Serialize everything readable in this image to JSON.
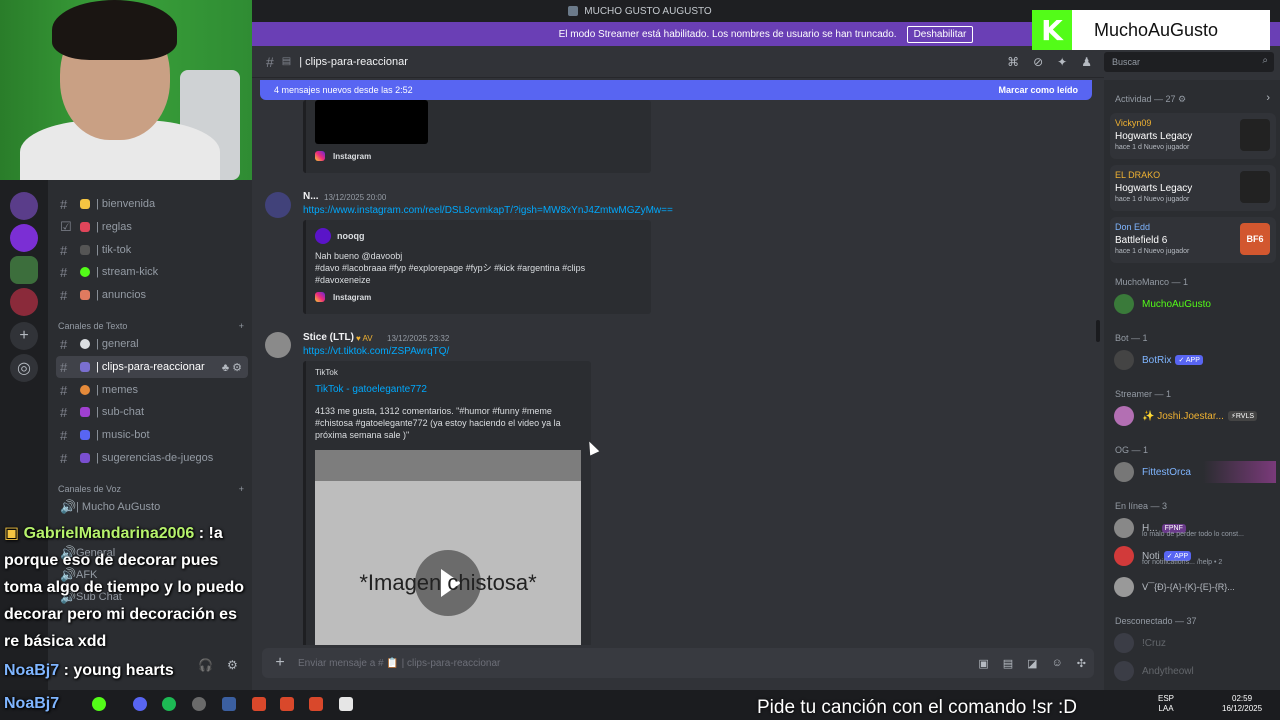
{
  "window": {
    "title": "MUCHO GUSTO AUGUSTO"
  },
  "banner": {
    "text": "El modo Streamer está habilitado. Los nombres de usuario se han truncado.",
    "button": "Deshabilitar"
  },
  "header": {
    "channel": "| clips-para-reaccionar"
  },
  "search": {
    "placeholder": "Buscar"
  },
  "new_messages": {
    "text": "4 mensajes nuevos desde las 2:52",
    "mark": "Marcar como leído"
  },
  "sidebar": {
    "channels_top": [
      "| bienvenida",
      "| reglas",
      "| tik-tok",
      "| stream-kick",
      "| anuncios"
    ],
    "text_category": "Canales de Texto",
    "text_channels": [
      "| general",
      "| clips-para-reaccionar",
      "| memes",
      "| sub-chat",
      "| music-bot",
      "| sugerencias-de-juegos"
    ],
    "voice_category": "Canales de Voz",
    "voice_channels": [
      "| Mucho AuGusto",
      "General",
      "AFK",
      "Sub Chat"
    ]
  },
  "messages": {
    "m0": {
      "embed_source": "Instagram"
    },
    "m1": {
      "user": "N...",
      "time": "13/12/2025 20:00",
      "link": "https://www.instagram.com/reel/DSL8cvmkapT/?igsh=MW8xYnJ4ZmtwMGZyMw==",
      "embed_author": "nooqg",
      "embed_line1": "Nah bueno @davoobj",
      "embed_line2": "#davo #lacobraaa #fyp #explorepage #fypシ #kick #argentina #clips",
      "embed_line3": "#davoxeneize",
      "embed_source": "Instagram"
    },
    "m2": {
      "user": "Stice (LTL)",
      "badge": "AV",
      "time": "13/12/2025 23:32",
      "link": "https://vt.tiktok.com/ZSPAwrqTQ/",
      "provider": "TikTok",
      "embed_title": "TikTok - gatoelegante772",
      "embed_line1": "4133 me gusta, 1312 comentarios. \"#humor #funny #meme",
      "embed_line2": "#chistosa #gatoelegante772 (ya estoy haciendo el video ya la",
      "embed_line3": "próxima semana sale )\"",
      "image_caption": "*Imagen chistosa*"
    }
  },
  "composer": {
    "placeholder": "Enviar mensaje a # 📋 | clips-para-reaccionar"
  },
  "members": {
    "activity_header": "Actividad — 27",
    "activities": [
      {
        "user": "Vickyn09",
        "game": "Hogwarts Legacy",
        "meta": "hace 1 d   Nuevo jugador"
      },
      {
        "user": "EL DRAKO",
        "game": "Hogwarts Legacy",
        "meta": "hace 1 d   Nuevo jugador"
      },
      {
        "user": "Don Edd",
        "game": "Battlefield 6",
        "meta": "hace 1 d   Nuevo jugador",
        "art": "BF6"
      }
    ],
    "groups": [
      {
        "header": "MuchoManco — 1",
        "items": [
          {
            "name": "MuchoAuGusto"
          }
        ]
      },
      {
        "header": "Bot — 1",
        "items": [
          {
            "name": "BotRix",
            "tag": "✓ APP"
          }
        ]
      },
      {
        "header": "Streamer — 1",
        "items": [
          {
            "name": "✨ Joshi.Joestar...",
            "tag": "⚡RVLS"
          }
        ]
      },
      {
        "header": "OG — 1",
        "items": [
          {
            "name": "FittestOrca"
          }
        ]
      },
      {
        "header": "En línea — 3",
        "items": [
          {
            "name": "H...",
            "tag": "FPNF",
            "sub": "lo malo de perder todo lo const..."
          },
          {
            "name": "Noti",
            "tag": "✓ APP",
            "sub": "for notifications... /help • 2"
          },
          {
            "name": "ᐯ‾‾{Ð}-{A}-{K}-{E}-{R}..."
          }
        ]
      },
      {
        "header": "Desconectado — 37",
        "items": [
          {
            "name": "!Cruz"
          },
          {
            "name": "Andytheowl"
          }
        ]
      }
    ]
  },
  "overlay": {
    "kick_name": "MuchoAuGusto",
    "kick_logo": "K",
    "chat": [
      {
        "user": "GabrielMandarina2006",
        "text": ": !a porque eso de decorar pues toma algo de tiempo y lo puedo decorar pero mi decoración es re básica xdd"
      },
      {
        "user": "NoaBj7",
        "text": ": young hearts"
      },
      {
        "user": "NoaBj7",
        "text": ""
      }
    ],
    "song": "Pide tu canción con el comando !sr :D"
  },
  "taskbar": {
    "lang": "ESP",
    "lang2": "LAA",
    "time": "02:59",
    "date": "16/12/2025"
  },
  "colors": {
    "accent": "#5865f2",
    "kick_green": "#53fc18",
    "link": "#00a8fc",
    "banner": "#6a3fb5"
  }
}
